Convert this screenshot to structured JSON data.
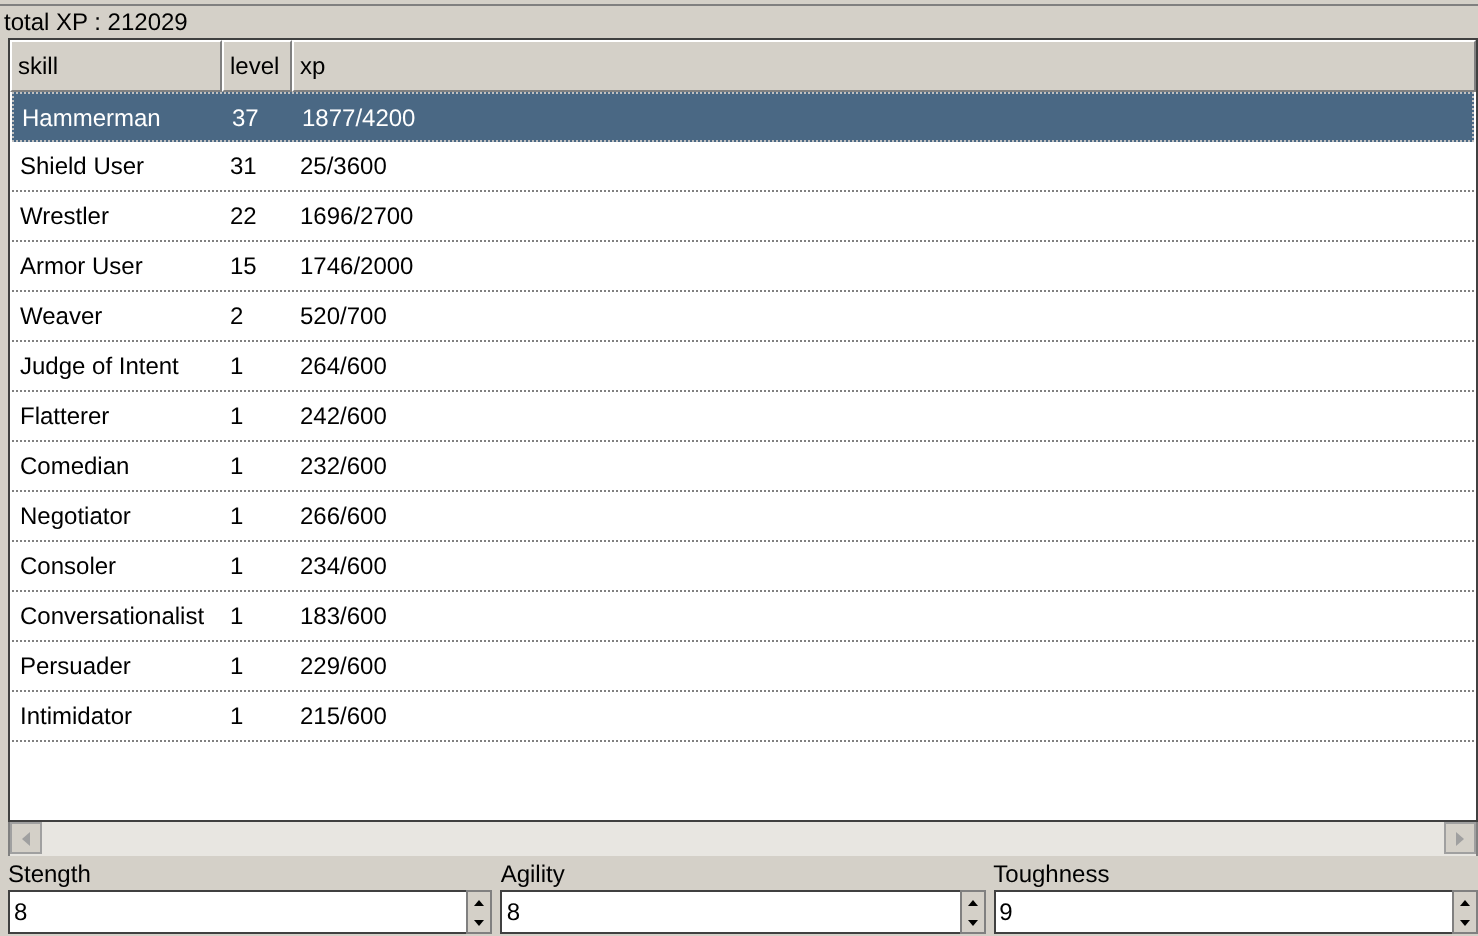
{
  "total_xp": "total XP : 212029",
  "table": {
    "columns": [
      "skill",
      "level",
      "xp"
    ],
    "rows": [
      {
        "skill": "Hammerman",
        "level": "37",
        "xp": "1877/4200",
        "selected": true
      },
      {
        "skill": "Shield User",
        "level": "31",
        "xp": "25/3600",
        "selected": false
      },
      {
        "skill": "Wrestler",
        "level": "22",
        "xp": "1696/2700",
        "selected": false
      },
      {
        "skill": "Armor User",
        "level": "15",
        "xp": "1746/2000",
        "selected": false
      },
      {
        "skill": "Weaver",
        "level": "2",
        "xp": "520/700",
        "selected": false
      },
      {
        "skill": "Judge of Intent",
        "level": "1",
        "xp": "264/600",
        "selected": false
      },
      {
        "skill": "Flatterer",
        "level": "1",
        "xp": "242/600",
        "selected": false
      },
      {
        "skill": "Comedian",
        "level": "1",
        "xp": "232/600",
        "selected": false
      },
      {
        "skill": "Negotiator",
        "level": "1",
        "xp": "266/600",
        "selected": false
      },
      {
        "skill": "Consoler",
        "level": "1",
        "xp": "234/600",
        "selected": false
      },
      {
        "skill": "Conversationalist",
        "level": "1",
        "xp": "183/600",
        "selected": false
      },
      {
        "skill": "Persuader",
        "level": "1",
        "xp": "229/600",
        "selected": false
      },
      {
        "skill": "Intimidator",
        "level": "1",
        "xp": "215/600",
        "selected": false
      }
    ]
  },
  "attributes": [
    {
      "label": "Stength",
      "value": "8"
    },
    {
      "label": "Agility",
      "value": "8"
    },
    {
      "label": "Toughness",
      "value": "9"
    }
  ]
}
